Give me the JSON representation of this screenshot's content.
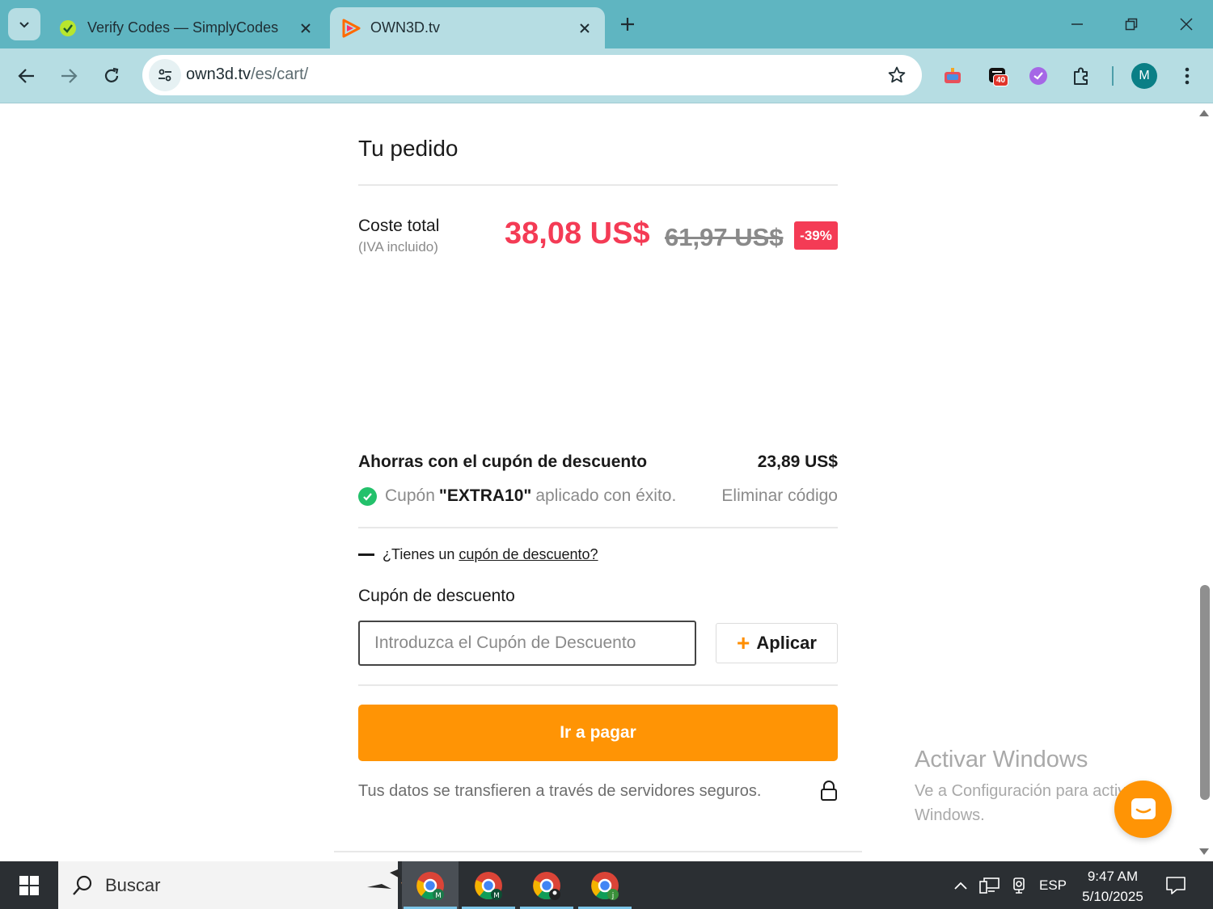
{
  "browser": {
    "tabs": [
      {
        "title": "Verify Codes — SimplyCodes",
        "active": false
      },
      {
        "title": "OWN3D.tv",
        "active": true
      }
    ],
    "url_host": "own3d.tv",
    "url_path": "/es/cart/",
    "profile_initial": "M",
    "extension_badge": "40"
  },
  "order": {
    "heading": "Tu pedido",
    "total_label": "Coste total",
    "total_sub": "(IVA incluido)",
    "price_new": "38,08 US$",
    "price_old": "61,97 US$",
    "discount": "-39%"
  },
  "coupon": {
    "savings_label": "Ahorras con el cupón de descuento",
    "savings_amount": "23,89 US$",
    "applied_prefix": "Cupón",
    "applied_code": "\"EXTRA10\"",
    "applied_suffix": "aplicado con éxito.",
    "remove_label": "Eliminar código",
    "toggle_prefix": "¿Tienes un",
    "toggle_link": "cupón de descuento?",
    "field_label": "Cupón de descuento",
    "input_placeholder": "Introduzca el Cupón de Descuento",
    "input_value": "",
    "apply_label": "Aplicar"
  },
  "checkout": {
    "pay_label": "Ir a pagar",
    "secure_note": "Tus datos se transfieren a través de servidores seguros."
  },
  "watermark": {
    "title": "Activar Windows",
    "line1": "Ve a Configuración para activar",
    "line2": "Windows."
  },
  "taskbar": {
    "search_placeholder": "Buscar",
    "language": "ESP",
    "time": "9:47 AM",
    "date": "5/10/2025"
  },
  "colors": {
    "accent_orange": "#ff9405",
    "price_red": "#f43b55",
    "success_green": "#23c16b",
    "chrome_teal": "#5fb5c1"
  }
}
